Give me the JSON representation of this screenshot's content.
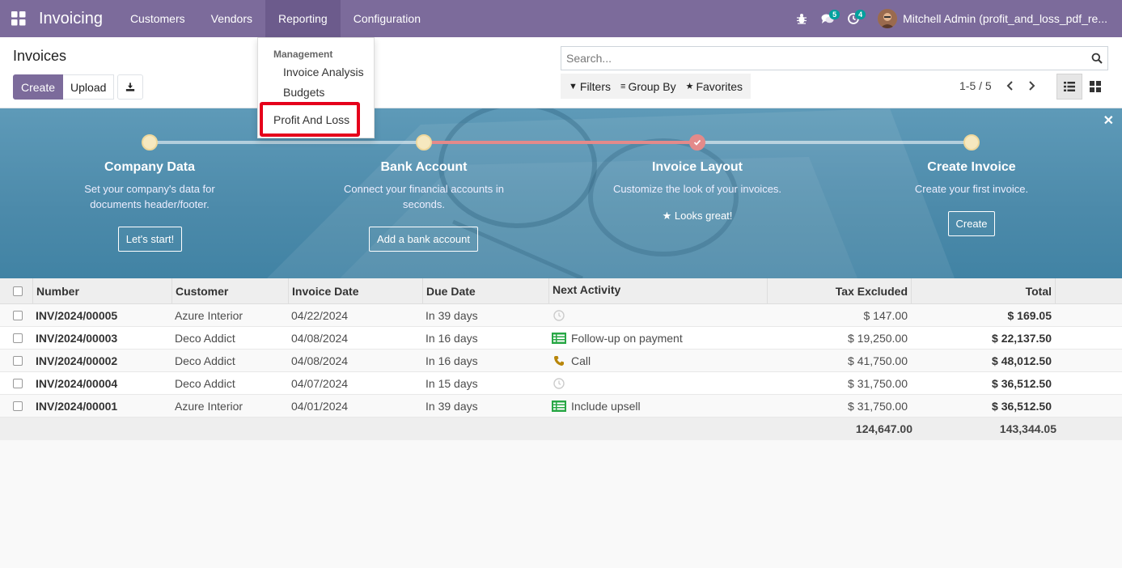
{
  "app": {
    "name": "Invoicing"
  },
  "nav": {
    "customers": "Customers",
    "vendors": "Vendors",
    "reporting": "Reporting",
    "configuration": "Configuration"
  },
  "systray": {
    "messages_count": "5",
    "activities_count": "4",
    "user_name": "Mitchell Admin (profit_and_loss_pdf_re..."
  },
  "reporting_menu": {
    "header": "Management",
    "items": [
      "Invoice Analysis",
      "Budgets",
      "Profit And Loss"
    ]
  },
  "control_panel": {
    "title": "Invoices",
    "create_label": "Create",
    "upload_label": "Upload",
    "search_placeholder": "Search...",
    "filters_label": "Filters",
    "groupby_label": "Group By",
    "favorites_label": "Favorites",
    "pager": "1-5 / 5"
  },
  "onboarding": {
    "steps": [
      {
        "title": "Company Data",
        "desc": "Set your company's data for documents header/footer.",
        "button": "Let's start!"
      },
      {
        "title": "Bank Account",
        "desc": "Connect your financial accounts in seconds.",
        "button": "Add a bank account"
      },
      {
        "title": "Invoice Layout",
        "desc": "Customize the look of your invoices.",
        "done_text": "Looks great!"
      },
      {
        "title": "Create Invoice",
        "desc": "Create your first invoice.",
        "button": "Create"
      }
    ],
    "colors": {
      "done": "#e38a8a",
      "pending": "#f6e8bf"
    }
  },
  "table": {
    "headers": {
      "number": "Number",
      "customer": "Customer",
      "invoice_date": "Invoice Date",
      "due_date": "Due Date",
      "next_activity": "Next Activity",
      "tax_excluded": "Tax Excluded",
      "total": "Total"
    },
    "rows": [
      {
        "number": "INV/2024/00005",
        "customer": "Azure Interior",
        "invoice_date": "04/22/2024",
        "due_date": "In 39 days",
        "activity": "",
        "activity_icon": "clock-icon",
        "tax_excluded": "$ 147.00",
        "total": "$ 169.05"
      },
      {
        "number": "INV/2024/00003",
        "customer": "Deco Addict",
        "invoice_date": "04/08/2024",
        "due_date": "In 16 days",
        "activity": "Follow-up on payment",
        "activity_icon": "list-icon",
        "tax_excluded": "$ 19,250.00",
        "total": "$ 22,137.50"
      },
      {
        "number": "INV/2024/00002",
        "customer": "Deco Addict",
        "invoice_date": "04/08/2024",
        "due_date": "In 16 days",
        "activity": "Call",
        "activity_icon": "phone-icon",
        "tax_excluded": "$ 41,750.00",
        "total": "$ 48,012.50"
      },
      {
        "number": "INV/2024/00004",
        "customer": "Deco Addict",
        "invoice_date": "04/07/2024",
        "due_date": "In 15 days",
        "activity": "",
        "activity_icon": "clock-icon",
        "tax_excluded": "$ 31,750.00",
        "total": "$ 36,512.50"
      },
      {
        "number": "INV/2024/00001",
        "customer": "Azure Interior",
        "invoice_date": "04/01/2024",
        "due_date": "In 39 days",
        "activity": "Include upsell",
        "activity_icon": "list-icon",
        "tax_excluded": "$ 31,750.00",
        "total": "$ 36,512.50"
      }
    ],
    "totals": {
      "tax_excluded": "124,647.00",
      "total": "143,344.05"
    }
  },
  "colors": {
    "brand": "#7c6b9b",
    "highlight": "#e5001b",
    "activity_green": "#28a745"
  }
}
